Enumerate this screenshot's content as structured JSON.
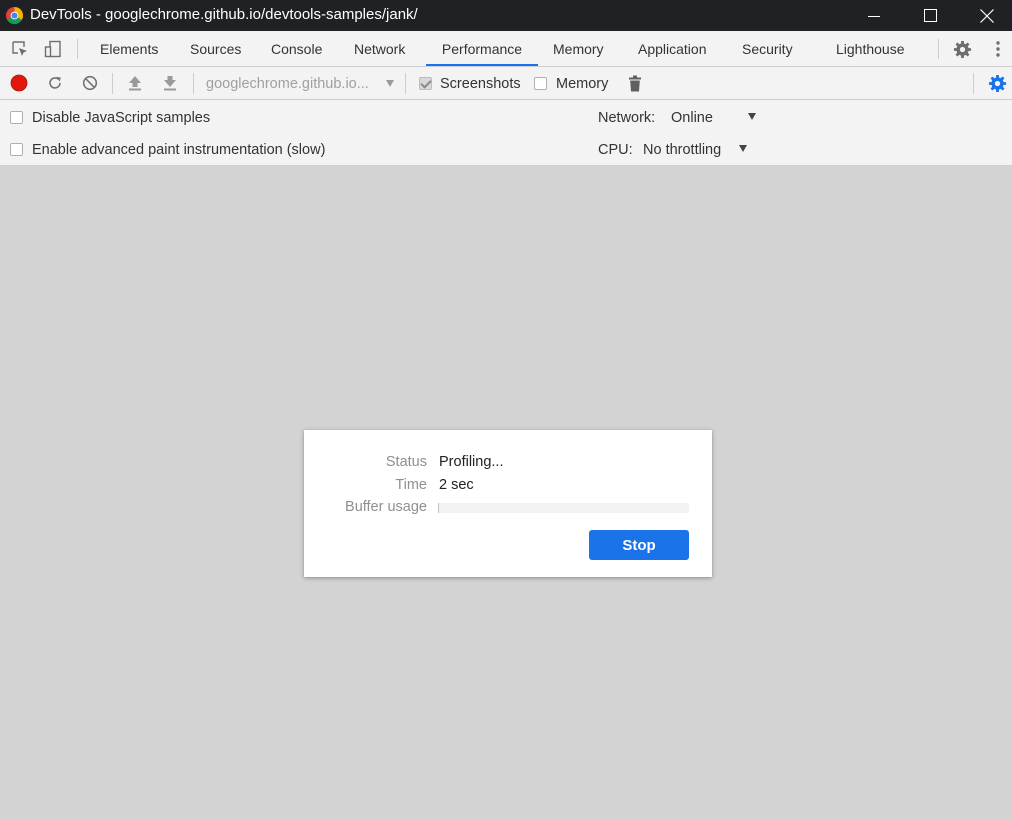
{
  "window": {
    "title": "DevTools - googlechrome.github.io/devtools-samples/jank/"
  },
  "tabs": [
    {
      "label": "Elements"
    },
    {
      "label": "Sources"
    },
    {
      "label": "Console"
    },
    {
      "label": "Network"
    },
    {
      "label": "Performance"
    },
    {
      "label": "Memory"
    },
    {
      "label": "Application"
    },
    {
      "label": "Security"
    },
    {
      "label": "Lighthouse"
    }
  ],
  "toolbar": {
    "profile_select": "googlechrome.github.io...",
    "screenshots_label": "Screenshots",
    "screenshots_checked": true,
    "memory_label": "Memory",
    "memory_checked": false
  },
  "settings": {
    "disable_js_samples_label": "Disable JavaScript samples",
    "advanced_paint_label": "Enable advanced paint instrumentation (slow)",
    "network_label": "Network:",
    "network_value": "Online",
    "cpu_label": "CPU:",
    "cpu_value": "No throttling"
  },
  "dialog": {
    "status_label": "Status",
    "status_value": "Profiling...",
    "time_label": "Time",
    "time_value": "2 sec",
    "buffer_label": "Buffer usage",
    "buffer_fraction": 0.004,
    "stop_label": "Stop"
  },
  "colors": {
    "accent": "#1a73e8",
    "record": "#e0190e",
    "titlebar": "#202124",
    "panel_bg": "#f3f3f3",
    "canvas_bg": "#d3d3d3"
  }
}
